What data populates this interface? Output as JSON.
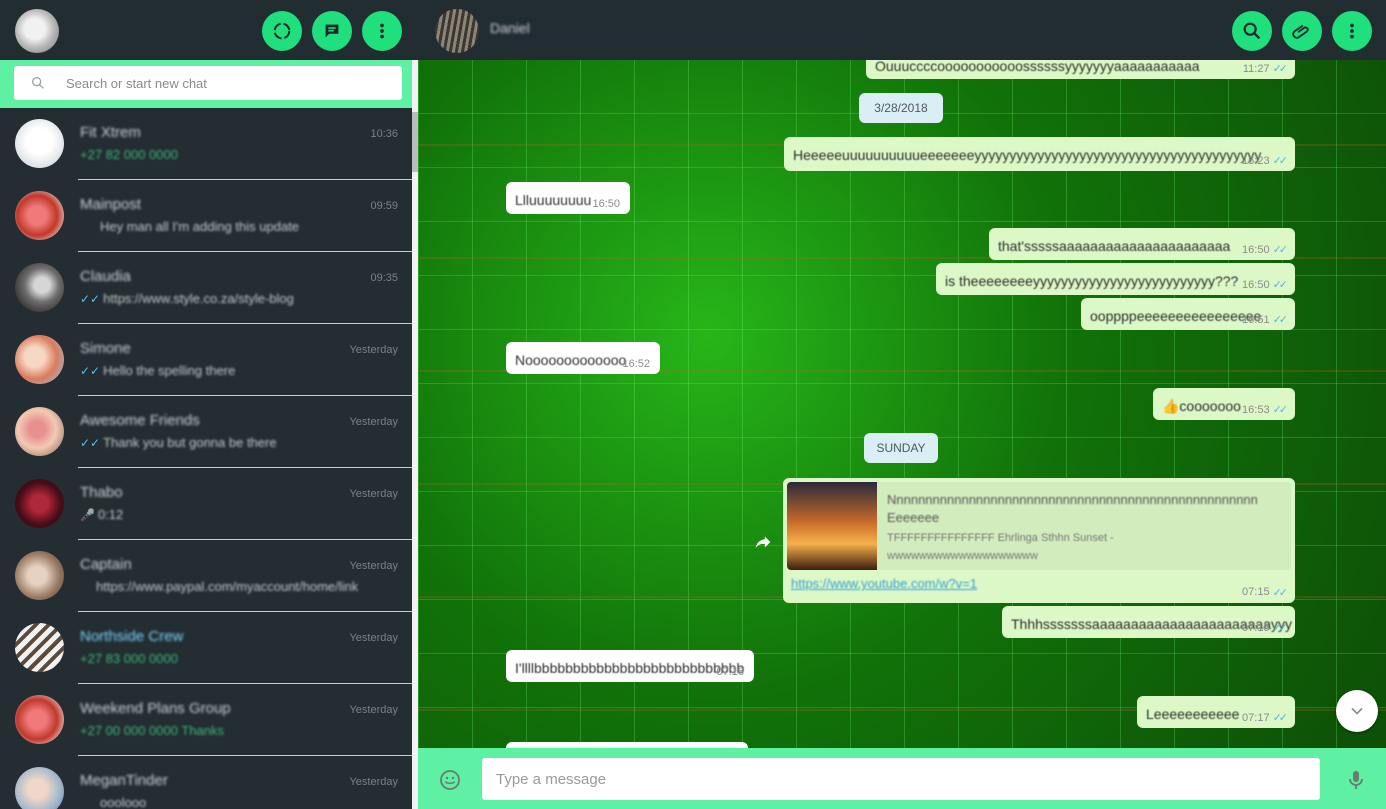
{
  "sidebar": {
    "search_placeholder": "Search or start new chat",
    "chats": [
      {
        "name": "Fit Xtrem",
        "time": "10:36",
        "preview": "+27 82 000 0000",
        "tick": false,
        "mic": false
      },
      {
        "name": "Mainpost",
        "time": "09:59",
        "preview": "Hey man all I'm adding this update",
        "tick": false,
        "mic": false
      },
      {
        "name": "Claudia",
        "time": "09:35",
        "preview": "https://www.style.co.za/style-blog",
        "tick": true,
        "mic": false
      },
      {
        "name": "Simone",
        "time": "Yesterday",
        "preview": "Hello the spelling there",
        "tick": true,
        "mic": false
      },
      {
        "name": "Awesome Friends",
        "time": "Yesterday",
        "preview": "Thank you but gonna be there",
        "tick": true,
        "mic": false
      },
      {
        "name": "Thabo",
        "time": "Yesterday",
        "preview": "0:12",
        "tick": false,
        "mic": true
      },
      {
        "name": "Captain",
        "time": "Yesterday",
        "preview": "https://www.paypal.com/myaccount/home/link",
        "tick": false,
        "mic": false
      },
      {
        "name": "Northside Crew",
        "time": "Yesterday",
        "preview": "+27 83 000 0000",
        "tick": false,
        "mic": false
      },
      {
        "name": "Weekend Plans Group",
        "time": "Yesterday",
        "preview": "+27 00 000 0000 Thanks",
        "tick": false,
        "mic": false
      },
      {
        "name": "MeganTinder",
        "time": "Yesterday",
        "preview": "ooolooo",
        "tick": false,
        "mic": false
      }
    ]
  },
  "header": {
    "contact_name": "Daniel"
  },
  "messages": [
    {
      "dir": "out",
      "text": "Ouuuccccooooooooooossssssyyyyyyyaaaaaaaaaaa",
      "time": "11:27"
    },
    {
      "dir": "date",
      "text": "3/28/2018"
    },
    {
      "dir": "out",
      "text": "Heeeeeuuuuuuuuuueeeeeeeyyyyyyyyyyyyyyyyyyyyyyyyyyyyyyyyyyyyyyyyy",
      "time": "16:23"
    },
    {
      "dir": "in",
      "text": "Llluuuuuuuu",
      "time": "16:50"
    },
    {
      "dir": "out",
      "text": "that'sssssaaaaaaaaaaaaaaaaaaaaaa",
      "time": "16:50"
    },
    {
      "dir": "out",
      "text": "is theeeeeeeeyyyyyyyyyyyyyyyyyyyyyyyyyy???",
      "time": "16:50"
    },
    {
      "dir": "out",
      "text": "ooppppeeeeeeeeeeeeeeee",
      "time": "16:51"
    },
    {
      "dir": "in",
      "text": "Nooooooooooooo",
      "time": "16:52"
    },
    {
      "dir": "out",
      "text": "👍cooooooo",
      "time": "16:53"
    },
    {
      "dir": "date",
      "text": "SUNDAY"
    },
    {
      "dir": "link",
      "title": "Nnnnnnnnnnnnnnnnnnnnnnnnnnnnnnnnnnnnnnnnnnnnnnnnnnn",
      "title2": "Eeeeeee",
      "desc": "TFFFFFFFFFFFFFFF Ehrlinga Sthhn Sunset -",
      "desc2": "wwwwwwwwwwwwwwwwwww",
      "url": "https://www.youtube.com/w?v=1",
      "time": "07:15"
    },
    {
      "dir": "out",
      "text": "Thhhsssssssaaaaaaaaaaaaaaaaaaaaaaayyy",
      "time": "07:15"
    },
    {
      "dir": "in",
      "text": "I'llllbbbbbbbbbbbbbbbbbbbbbbbbbbb",
      "time": "07:16"
    },
    {
      "dir": "out",
      "text": "Leeeeeeeeeee",
      "time": "07:17"
    }
  ],
  "footer": {
    "input_placeholder": "Type a message"
  },
  "colors": {
    "accent": "#1fe07d",
    "footer": "#5ef0a3",
    "bubble_out": "#dcf8c6",
    "bubble_in": "#ffffff",
    "tick": "#4fb6ec"
  },
  "icons": [
    "status-icon",
    "new-chat-icon",
    "menu-icon",
    "search-icon",
    "attach-icon",
    "forward-icon",
    "chevron-down-icon",
    "emoji-icon",
    "mic-icon"
  ]
}
